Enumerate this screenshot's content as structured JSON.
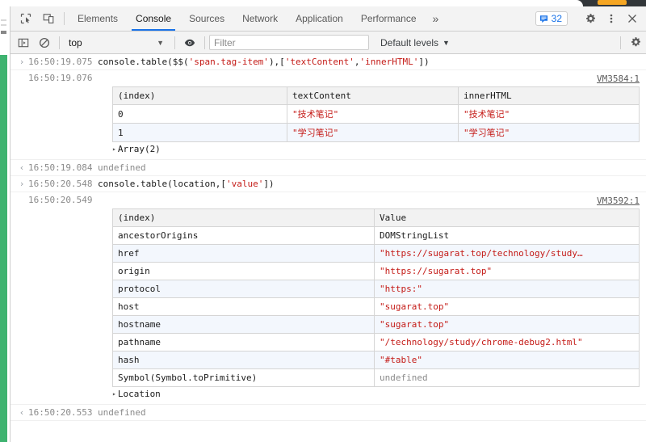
{
  "window": {
    "title": "Chrome DevTools - Console"
  },
  "tabbar": {
    "inspect_icon": "inspect-element-icon",
    "device_icon": "device-toolbar-icon",
    "tabs": [
      {
        "label": "Elements",
        "selected": false
      },
      {
        "label": "Console",
        "selected": true
      },
      {
        "label": "Sources",
        "selected": false
      },
      {
        "label": "Network",
        "selected": false
      },
      {
        "label": "Application",
        "selected": false
      },
      {
        "label": "Performance",
        "selected": false
      }
    ],
    "more_label": "»",
    "issues": {
      "icon": "issues-message-icon",
      "count": "32",
      "color": "#1a73e8"
    },
    "settings_icon": "gear-icon",
    "more_options_icon": "kebab-menu-icon",
    "close_icon": "close-icon"
  },
  "filterbar": {
    "sidebar_icon": "console-sidebar-icon",
    "clear_icon": "clear-console-icon",
    "context": "top",
    "context_arrow": "▼",
    "eye_icon": "live-expression-icon",
    "filter": {
      "placeholder": "Filter",
      "value": ""
    },
    "levels_label": "Default levels",
    "levels_arrow": "▼",
    "settings_icon": "console-settings-gear-icon"
  },
  "console": {
    "entries": [
      {
        "kind": "command",
        "arrow": "›",
        "timestamp": "16:50:19.075",
        "code_parts": [
          {
            "t": "console.table($$(",
            "c": "plain"
          },
          {
            "t": "'span.tag-item'",
            "c": "string"
          },
          {
            "t": "),[",
            "c": "plain"
          },
          {
            "t": "'textContent'",
            "c": "string"
          },
          {
            "t": ",",
            "c": "plain"
          },
          {
            "t": "'innerHTML'",
            "c": "string"
          },
          {
            "t": "])",
            "c": "plain"
          }
        ]
      },
      {
        "kind": "table",
        "timestamp": "16:50:19.076",
        "vmlink": "VM3584:1",
        "columns": [
          "(index)",
          "textContent",
          "innerHTML"
        ],
        "column_widths": [
          "216px",
          "212px",
          "224px"
        ],
        "rows": [
          {
            "cells": [
              {
                "text": "0",
                "style": "index"
              },
              {
                "text": "\"技术笔记\"",
                "style": "string"
              },
              {
                "text": "\"技术笔记\"",
                "style": "string"
              }
            ]
          },
          {
            "cells": [
              {
                "text": "1",
                "style": "index"
              },
              {
                "text": "\"学习笔记\"",
                "style": "string"
              },
              {
                "text": "\"学习笔记\"",
                "style": "string"
              }
            ]
          }
        ],
        "expander": "Array(2)",
        "expander_triangle": "▸"
      },
      {
        "kind": "output",
        "arrow": "‹",
        "timestamp": "16:50:19.084",
        "value": "undefined"
      },
      {
        "kind": "command",
        "arrow": "›",
        "timestamp": "16:50:20.548",
        "code_parts": [
          {
            "t": "console.table(location,[",
            "c": "plain"
          },
          {
            "t": "'value'",
            "c": "string"
          },
          {
            "t": "])",
            "c": "plain"
          }
        ]
      },
      {
        "kind": "table",
        "timestamp": "16:50:20.549",
        "vmlink": "VM3592:1",
        "columns": [
          "(index)",
          "Value"
        ],
        "column_widths": [
          "324px",
          "328px"
        ],
        "rows": [
          {
            "cells": [
              {
                "text": "ancestorOrigins",
                "style": "index"
              },
              {
                "text": "DOMStringList",
                "style": "plain"
              }
            ]
          },
          {
            "cells": [
              {
                "text": "href",
                "style": "index"
              },
              {
                "text": "\"https://sugarat.top/technology/study…",
                "style": "string"
              }
            ]
          },
          {
            "cells": [
              {
                "text": "origin",
                "style": "index"
              },
              {
                "text": "\"https://sugarat.top\"",
                "style": "string"
              }
            ]
          },
          {
            "cells": [
              {
                "text": "protocol",
                "style": "index"
              },
              {
                "text": "\"https:\"",
                "style": "string"
              }
            ]
          },
          {
            "cells": [
              {
                "text": "host",
                "style": "index"
              },
              {
                "text": "\"sugarat.top\"",
                "style": "string"
              }
            ]
          },
          {
            "cells": [
              {
                "text": "hostname",
                "style": "index"
              },
              {
                "text": "\"sugarat.top\"",
                "style": "string"
              }
            ]
          },
          {
            "cells": [
              {
                "text": "pathname",
                "style": "index"
              },
              {
                "text": "\"/technology/study/chrome-debug2.html\"",
                "style": "string"
              }
            ]
          },
          {
            "cells": [
              {
                "text": "hash",
                "style": "index"
              },
              {
                "text": "\"#table\"",
                "style": "string"
              }
            ]
          },
          {
            "cells": [
              {
                "text": "Symbol(Symbol.toPrimitive)",
                "style": "index"
              },
              {
                "text": "undefined",
                "style": "undefined"
              }
            ]
          }
        ],
        "expander": "Location",
        "expander_triangle": "▸"
      },
      {
        "kind": "output",
        "arrow": "‹",
        "timestamp": "16:50:20.553",
        "value": "undefined"
      }
    ]
  },
  "colors": {
    "accent": "#1a73e8",
    "string": "#c41a16",
    "muted": "#8a8a8a",
    "page_accent": "#3eb370",
    "toolbar_bg": "#f3f3f3"
  }
}
